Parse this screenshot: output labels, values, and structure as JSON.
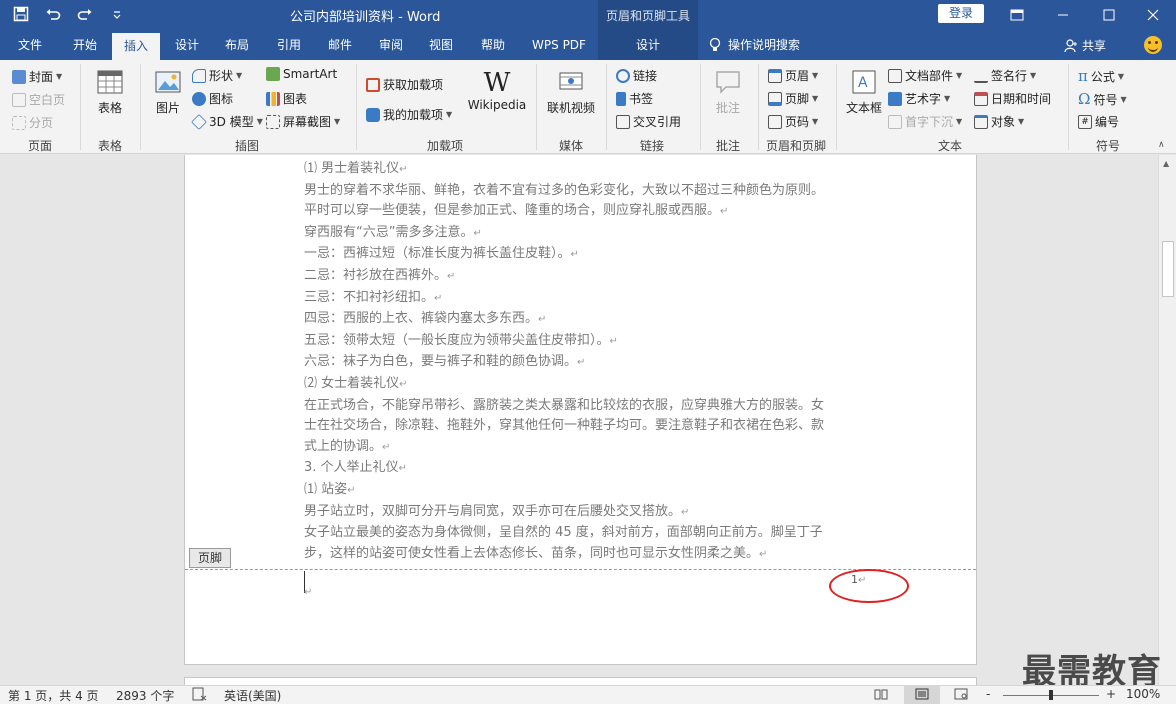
{
  "title_bar": {
    "doc_title": "公司内部培训资料  -  Word",
    "context_tool": "页眉和页脚工具",
    "login": "登录"
  },
  "tabs": [
    "文件",
    "开始",
    "插入",
    "设计",
    "布局",
    "引用",
    "邮件",
    "审阅",
    "视图",
    "帮助",
    "WPS PDF",
    "设计"
  ],
  "active_tab": "插入",
  "search_hint": "操作说明搜索",
  "share": "共享",
  "ribbon": {
    "page_group": {
      "cover": "封面",
      "blank": "空白页",
      "break": "分页",
      "label": "页面"
    },
    "table_group": {
      "table": "表格",
      "label": "表格"
    },
    "illust_group": {
      "pictures": "图片",
      "shapes": "形状",
      "icons": "图标",
      "model3d": "3D 模型",
      "smartart": "SmartArt",
      "chart": "图表",
      "screenshot": "屏幕截图",
      "label": "插图"
    },
    "addin_group": {
      "get": "获取加载项",
      "mine": "我的加载项",
      "wiki_glyph": "W",
      "wikipedia": "Wikipedia",
      "label": "加载项"
    },
    "media_group": {
      "video": "联机视频",
      "label": "媒体"
    },
    "link_group": {
      "link": "链接",
      "bookmark": "书签",
      "xref": "交叉引用",
      "label": "链接"
    },
    "comment_group": {
      "comment": "批注",
      "label": "批注"
    },
    "hf_group": {
      "header": "页眉",
      "footer": "页脚",
      "pagenum": "页码",
      "label": "页眉和页脚"
    },
    "text_group": {
      "textbox": "文本框",
      "quickparts": "文档部件",
      "wordart": "艺术字",
      "dropcap": "首字下沉",
      "sigline": "签名行",
      "datetime": "日期和时间",
      "object": "对象",
      "label": "文本"
    },
    "symbol_group": {
      "equation": "公式",
      "symbol": "符号",
      "number": "编号",
      "label": "符号"
    }
  },
  "document": {
    "lines": [
      "⑴ 男士着装礼仪",
      "男士的穿着不求华丽、鲜艳，衣着不宜有过多的色彩变化，大致以不超过三种颜色为原则。",
      "平时可以穿一些便装，但是参加正式、隆重的场合，则应穿礼服或西服。",
      "穿西服有“六忌”需多多注意。",
      "一忌：西裤过短（标准长度为裤长盖住皮鞋）。",
      "二忌：衬衫放在西裤外。",
      "三忌：不扣衬衫纽扣。",
      "四忌：西服的上衣、裤袋内塞太多东西。",
      "五忌：领带太短（一般长度应为领带尖盖住皮带扣）。",
      "六忌：袜子为白色，要与裤子和鞋的颜色协调。",
      "⑵ 女士着装礼仪",
      "在正式场合，不能穿吊带衫、露脐装之类太暴露和比较炫的衣服，应穿典雅大方的服装。女",
      "士在社交场合，除凉鞋、拖鞋外，穿其他任何一种鞋子均可。要注意鞋子和衣裙在色彩、款",
      "式上的协调。",
      "3. 个人举止礼仪",
      "⑴ 站姿",
      "男子站立时，双脚可分开与肩同宽，双手亦可在后腰处交叉搭放。",
      "女子站立最美的姿态为身体微侧，呈自然的 45 度，斜对前方，面部朝向正前方。脚呈丁子",
      "步，这样的站姿可使女性看上去体态修长、苗条，同时也可显示女性阴柔之美。"
    ],
    "paragraph_mark": "↵",
    "footer_tag": "页脚",
    "page_number": "1"
  },
  "status": {
    "page": "第 1 页，共 4 页",
    "words": "2893 个字",
    "language": "英语(美国)",
    "zoom": "100%",
    "zoom_minus": "-",
    "zoom_plus": "+"
  },
  "watermark": "最需教育",
  "colors": {
    "title_blue": "#2b579a",
    "annotation_red": "#e02020"
  }
}
